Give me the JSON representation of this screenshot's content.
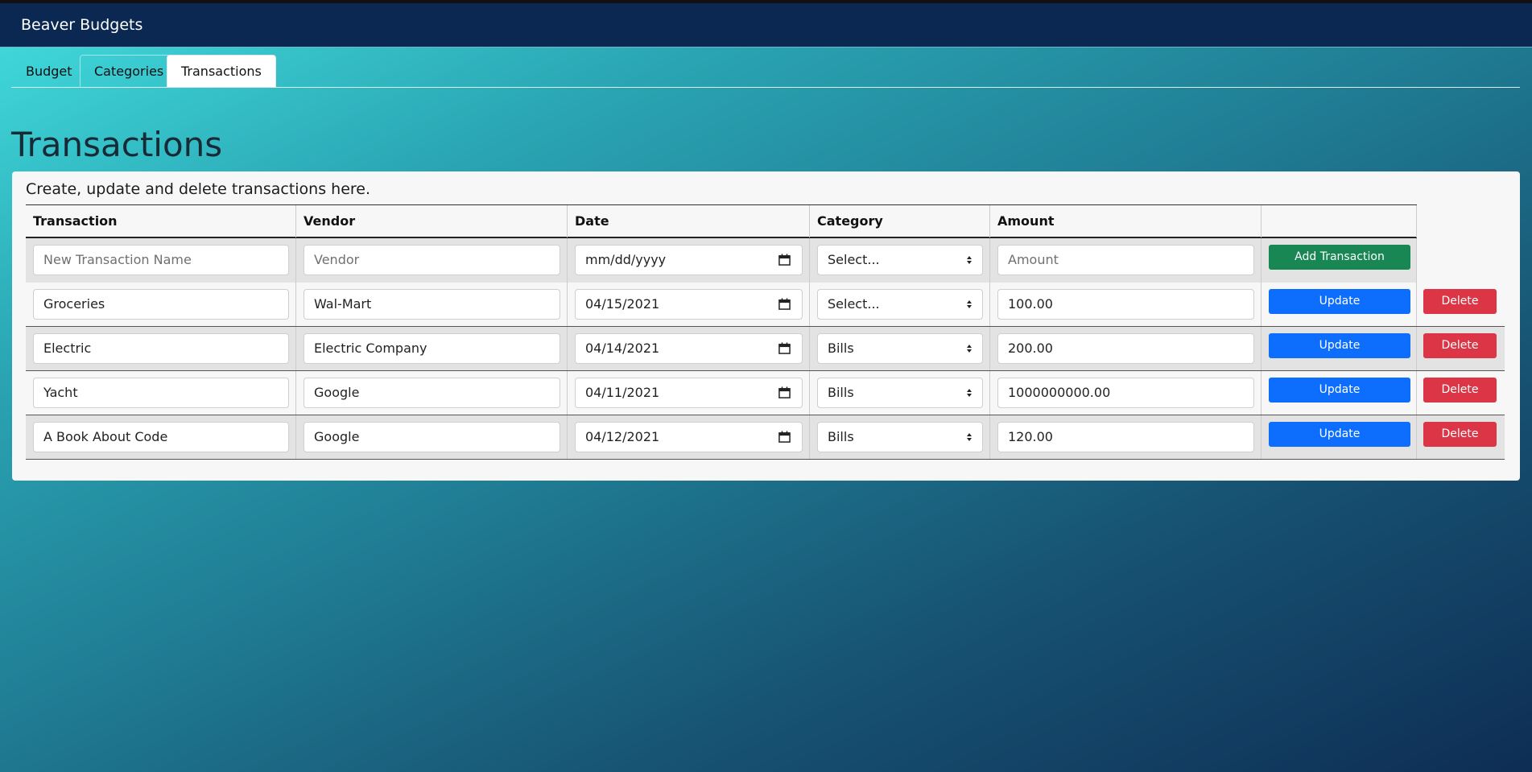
{
  "app": {
    "title": "Beaver Budgets"
  },
  "tabs": [
    {
      "label": "Budget"
    },
    {
      "label": "Categories"
    },
    {
      "label": "Transactions",
      "active": true
    }
  ],
  "page": {
    "title": "Transactions",
    "description": "Create, update and delete transactions here."
  },
  "table": {
    "headers": [
      "Transaction",
      "Vendor",
      "Date",
      "Category",
      "Amount",
      ""
    ],
    "new_row": {
      "name_placeholder": "New Transaction Name",
      "vendor_placeholder": "Vendor",
      "date_placeholder": "mm/dd/yyyy",
      "category": "Select...",
      "amount_placeholder": "Amount",
      "add_label": "Add Transaction"
    },
    "rows": [
      {
        "name": "Groceries",
        "vendor": "Wal-Mart",
        "date": "04/15/2021",
        "category": "Select...",
        "amount": "100.00",
        "update_label": "Update",
        "delete_label": "Delete"
      },
      {
        "name": "Electric",
        "vendor": "Electric Company",
        "date": "04/14/2021",
        "category": "Bills",
        "amount": "200.00",
        "update_label": "Update",
        "delete_label": "Delete"
      },
      {
        "name": "Yacht",
        "vendor": "Google",
        "date": "04/11/2021",
        "category": "Bills",
        "amount": "1000000000.00",
        "update_label": "Update",
        "delete_label": "Delete"
      },
      {
        "name": "A Book About Code",
        "vendor": "Google",
        "date": "04/12/2021",
        "category": "Bills",
        "amount": "120.00",
        "update_label": "Update",
        "delete_label": "Delete"
      }
    ]
  },
  "icons": {
    "date": "calendar-icon",
    "select": "chevron-updown-icon"
  },
  "colors": {
    "navbar": "#0b2852",
    "add": "#198754",
    "update": "#0d6efd",
    "delete": "#dc3545"
  }
}
